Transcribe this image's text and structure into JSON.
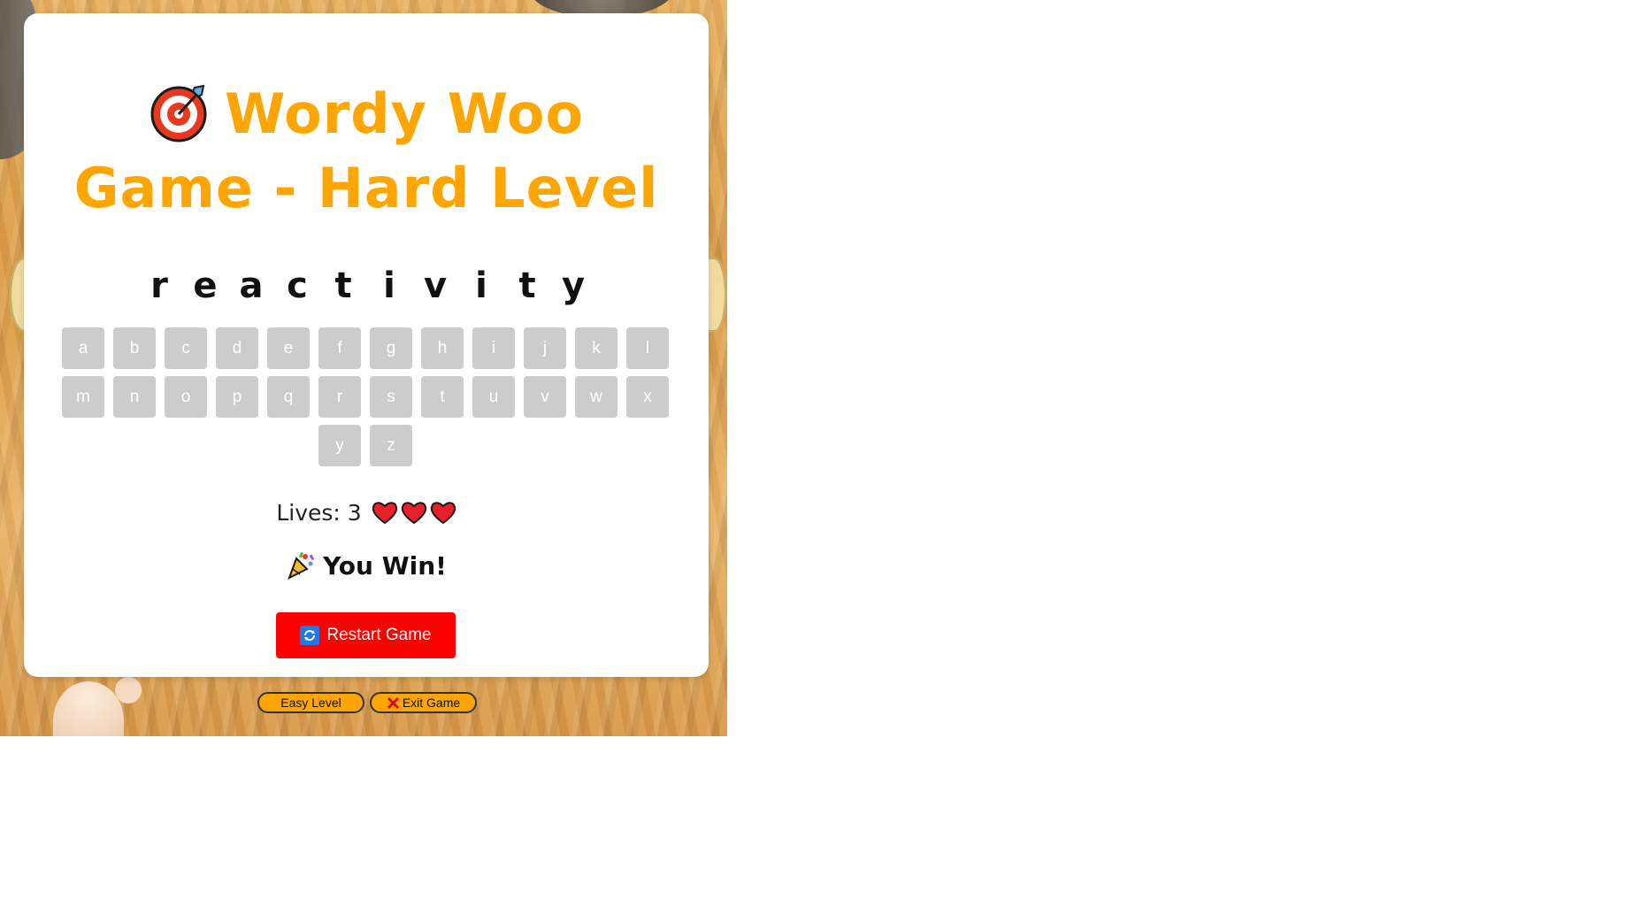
{
  "game": {
    "title": "Wordy Woo Game - Hard Level",
    "word_letters": [
      "r",
      "e",
      "a",
      "c",
      "t",
      "i",
      "v",
      "i",
      "t",
      "y"
    ],
    "keyboard_rows": [
      [
        "a",
        "b",
        "c",
        "d",
        "e",
        "f",
        "g",
        "h",
        "i",
        "j",
        "k",
        "l"
      ],
      [
        "m",
        "n",
        "o",
        "p",
        "q",
        "r",
        "s",
        "t",
        "u",
        "v",
        "w",
        "x"
      ],
      [
        "y",
        "z"
      ]
    ],
    "lives_label": "Lives: 3",
    "hearts_count": 3,
    "status_text": "You Win!",
    "restart_label": "Restart Game"
  },
  "footer": {
    "easy_label": "Easy Level",
    "exit_label": "Exit Game"
  },
  "colors": {
    "title": "#ffa500",
    "key_bg": "#cccccc",
    "restart_bg": "#ff0000",
    "footer_bg": "#ffa500"
  },
  "icons": {
    "title": "target-icon",
    "hearts": "heart-icon",
    "status": "party-popper-icon",
    "restart": "refresh-icon",
    "exit": "cross-icon"
  }
}
